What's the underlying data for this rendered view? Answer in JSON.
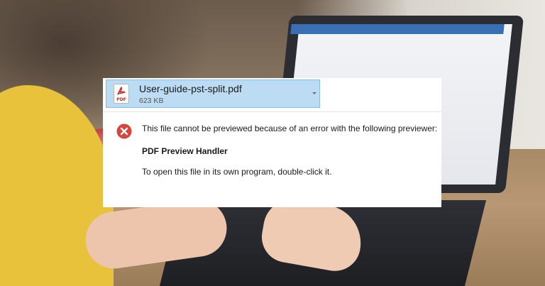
{
  "attachment": {
    "file_type": "PDF",
    "filename": "User-guide-pst-split.pdf",
    "size": "623 KB",
    "icon": "pdf-file-icon"
  },
  "error": {
    "icon": "error-x-icon",
    "message": "This file cannot be previewed because of an error with the following previewer:",
    "previewer": "PDF Preview Handler",
    "hint": "To open this file in its own program, double-click it."
  },
  "colors": {
    "attachment_background": "#bcdcf3",
    "attachment_border": "#86bde6",
    "error_red": "#d9453d",
    "pdf_red": "#c4302b"
  }
}
